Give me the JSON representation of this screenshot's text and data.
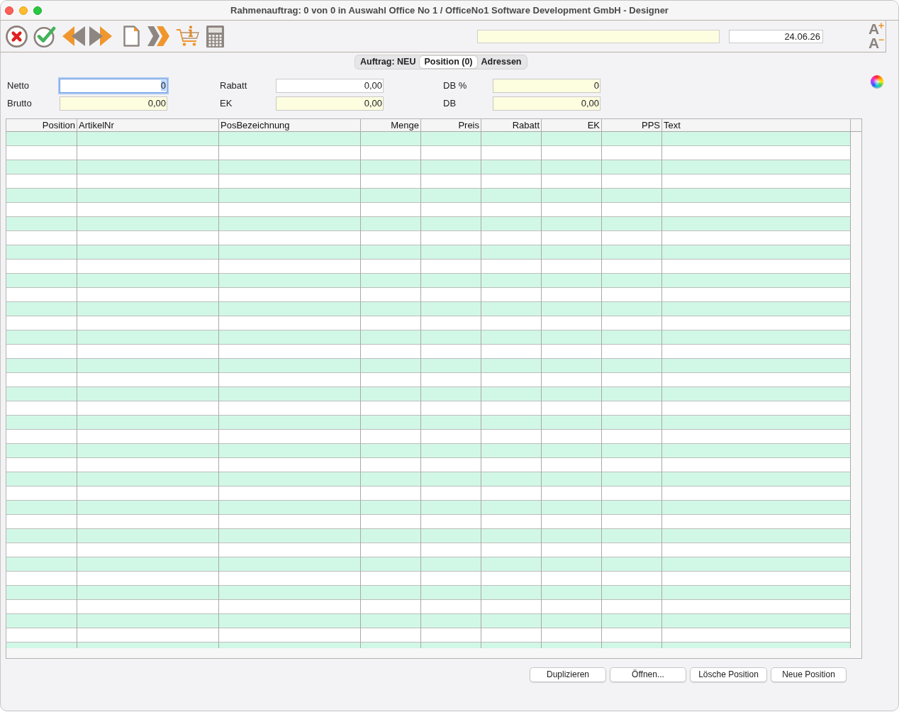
{
  "window": {
    "title": "Rahmenauftrag: 0 von 0 in Auswahl Office No 1 / OfficeNo1 Software Development GmbH - Designer"
  },
  "toolbar": {
    "date": "24.06.26",
    "font_buttons": [
      {
        "letter": "A",
        "sign": "+"
      },
      {
        "letter": "A",
        "sign": "−"
      }
    ]
  },
  "tabs": [
    {
      "label": "Auftrag: NEU",
      "selected": false
    },
    {
      "label": "Position (0)",
      "selected": true
    },
    {
      "label": "Adressen",
      "selected": false
    }
  ],
  "fields": [
    {
      "label": "Netto",
      "value": "0",
      "readonly": false,
      "focused": true
    },
    {
      "label": "Rabatt",
      "value": "0,00",
      "readonly": false,
      "focused": false
    },
    {
      "label": "DB %",
      "value": "0",
      "readonly": true,
      "focused": false
    },
    {
      "label": "Brutto",
      "value": "0,00",
      "readonly": true,
      "focused": false
    },
    {
      "label": "EK",
      "value": "0,00",
      "readonly": true,
      "focused": false
    },
    {
      "label": "DB",
      "value": "0,00",
      "readonly": true,
      "focused": false
    }
  ],
  "table": {
    "columns": [
      {
        "label": "Position",
        "numeric": true
      },
      {
        "label": "ArtikelNr",
        "numeric": false
      },
      {
        "label": "PosBezeichnung",
        "numeric": false
      },
      {
        "label": "Menge",
        "numeric": true
      },
      {
        "label": "Preis",
        "numeric": true
      },
      {
        "label": "Rabatt",
        "numeric": true
      },
      {
        "label": "EK",
        "numeric": true
      },
      {
        "label": "PPS",
        "numeric": true
      },
      {
        "label": "Text",
        "numeric": false
      }
    ]
  },
  "buttons": [
    "Duplizieren",
    "Öffnen...",
    "Lösche Position",
    "Neue Position"
  ]
}
